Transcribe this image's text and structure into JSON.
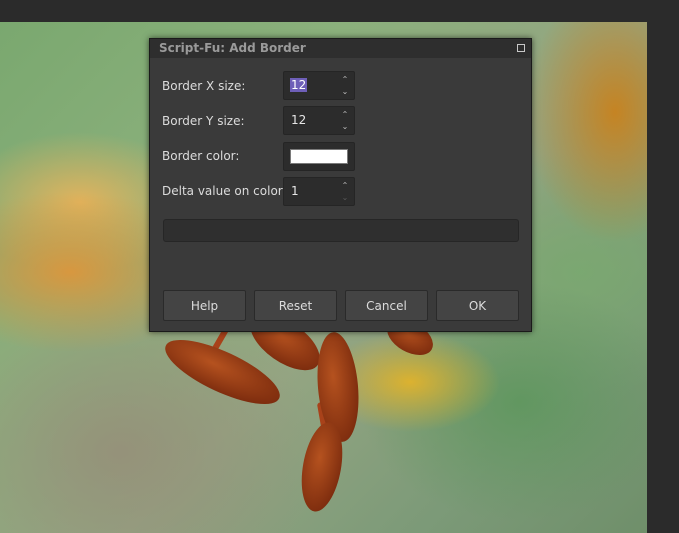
{
  "dialog": {
    "title": "Script-Fu: Add Border",
    "fields": [
      {
        "label": "Border X size:",
        "value": "12",
        "selected": true,
        "up_enabled": true,
        "down_enabled": true
      },
      {
        "label": "Border Y size:",
        "value": "12",
        "selected": false,
        "up_enabled": true,
        "down_enabled": true
      },
      {
        "label": "Border color:",
        "color": "#ffffff"
      },
      {
        "label": "Delta value on color:",
        "value": "1",
        "selected": false,
        "up_enabled": true,
        "down_enabled": false
      }
    ],
    "buttons": {
      "help": "Help",
      "reset": "Reset",
      "cancel": "Cancel",
      "ok": "OK"
    },
    "selection_color": "#6e5fb8"
  }
}
